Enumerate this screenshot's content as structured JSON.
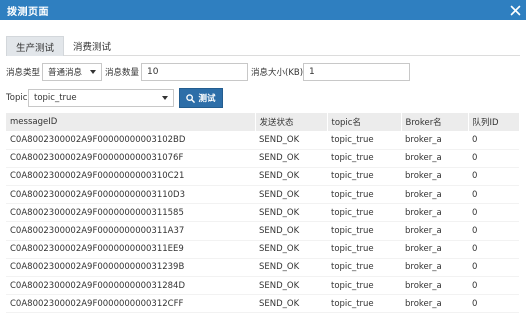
{
  "dialog": {
    "title": "拨测页面",
    "close_icon": "close-icon"
  },
  "tabs": [
    {
      "label": "生产测试",
      "active": true
    },
    {
      "label": "消费测试",
      "active": false
    }
  ],
  "form": {
    "msg_type_label": "消息类型",
    "msg_type_value": "普通消息",
    "msg_count_label": "消息数量",
    "msg_count_value": "10",
    "msg_size_label": "消息大小(KB)",
    "msg_size_value": "1",
    "topic_label": "Topic",
    "topic_value": "topic_true",
    "test_button": "测试",
    "search_icon": "search-icon"
  },
  "table": {
    "headers": [
      "messageID",
      "发送状态",
      "topic名",
      "Broker名",
      "队列ID"
    ],
    "rows": [
      [
        "C0A8002300002A9F00000000003102BD",
        "SEND_OK",
        "topic_true",
        "broker_a",
        "0"
      ],
      [
        "C0A8002300002A9F000000000031076F",
        "SEND_OK",
        "topic_true",
        "broker_a",
        "0"
      ],
      [
        "C0A8002300002A9F0000000000310C21",
        "SEND_OK",
        "topic_true",
        "broker_a",
        "0"
      ],
      [
        "C0A8002300002A9F00000000003110D3",
        "SEND_OK",
        "topic_true",
        "broker_a",
        "0"
      ],
      [
        "C0A8002300002A9F0000000000311585",
        "SEND_OK",
        "topic_true",
        "broker_a",
        "0"
      ],
      [
        "C0A8002300002A9F0000000000311A37",
        "SEND_OK",
        "topic_true",
        "broker_a",
        "0"
      ],
      [
        "C0A8002300002A9F0000000000311EE9",
        "SEND_OK",
        "topic_true",
        "broker_a",
        "0"
      ],
      [
        "C0A8002300002A9F000000000031239B",
        "SEND_OK",
        "topic_true",
        "broker_a",
        "0"
      ],
      [
        "C0A8002300002A9F000000000031284D",
        "SEND_OK",
        "topic_true",
        "broker_a",
        "0"
      ],
      [
        "C0A8002300002A9F0000000000312CFF",
        "SEND_OK",
        "topic_true",
        "broker_a",
        "0"
      ]
    ]
  },
  "colors": {
    "titlebar": "#2f7fc0",
    "button": "#2d6ea8",
    "header_bg": "#ececec"
  }
}
